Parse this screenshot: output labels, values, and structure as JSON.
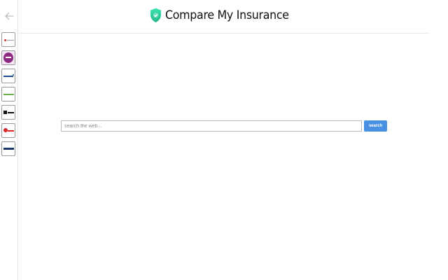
{
  "header": {
    "title": "Compare My Insurance",
    "logo_icon": "shield-check-icon",
    "logo_colors": {
      "top": "#3ee0b0",
      "bottom": "#1fb98a",
      "check": "#ffffff"
    }
  },
  "nav": {
    "back_icon": "arrow-left-icon",
    "back_color": "#bdbdbd"
  },
  "sidebar": {
    "tiles": [
      {
        "icon": "insurance-logo-1-icon",
        "color": "#d9393e"
      },
      {
        "icon": "insurance-logo-2-icon",
        "color": "#8c2a82"
      },
      {
        "icon": "insurance-logo-3-icon",
        "color": "#1d4f91"
      },
      {
        "icon": "insurance-logo-4-icon",
        "color": "#6ab04c"
      },
      {
        "icon": "insurance-logo-5-icon",
        "color": "#111111"
      },
      {
        "icon": "insurance-logo-6-icon",
        "color": "#d62828"
      },
      {
        "icon": "insurance-logo-7-icon",
        "color": "#1b3a6b"
      }
    ]
  },
  "search": {
    "placeholder": "search the web...",
    "value": "",
    "button_label": "search",
    "button_color": "#4a90e2"
  }
}
